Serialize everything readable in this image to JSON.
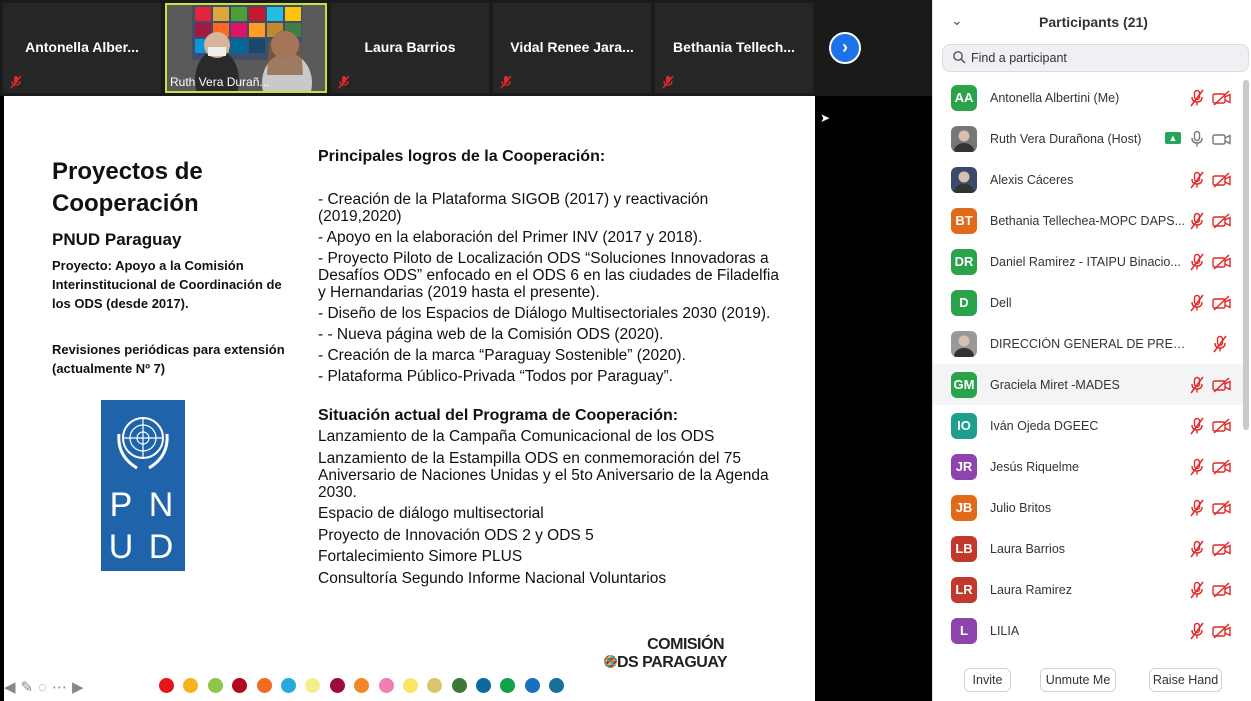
{
  "video_strip": {
    "tiles": [
      {
        "name": "Antonella  Alber..."
      },
      {
        "name": "Ruth Vera Durañ..."
      },
      {
        "name": "Laura Barrios"
      },
      {
        "name": "Vidal Renee Jara..."
      },
      {
        "name": "Bethania  Tellech..."
      }
    ]
  },
  "slide": {
    "left_title": "Proyectos de Cooperación",
    "left_subtitle": "PNUD Paraguay",
    "left_project": "Proyecto: Apoyo a la Comisión Interinstitucional de Coordinación de los ODS (desde 2017).",
    "left_revisions": "Revisiones periódicas para extensión (actualmente Nº 7)",
    "logo_letters": [
      "P",
      "N",
      "U",
      "D"
    ],
    "achievements_title": "Principales logros de la Cooperación:",
    "achievements": [
      "- Creación de la Plataforma SIGOB (2017) y reactivación (2019,2020)",
      "- Apoyo en la elaboración del Primer INV (2017 y 2018).",
      "- Proyecto Piloto de Localización ODS “Soluciones Innovadoras a Desafíos ODS” enfocado en el ODS 6 en las ciudades de Filadelfia y Hernandarias (2019 hasta el presente).",
      "- Diseño de los Espacios de Diálogo Multisectoriales 2030 (2019).",
      "- - Nueva página web de la Comisión ODS (2020).",
      "- Creación de la marca “Paraguay Sostenible” (2020).",
      " - Plataforma Público-Privada “Todos por Paraguay”."
    ],
    "status_title": "Situación actual del Programa de Cooperación:",
    "status_items": [
      "Lanzamiento de la Campaña Comunicacional de los ODS",
      "Lanzamiento de la Estampilla ODS en conmemoración del 75 Aniversario de Naciones Unidas y el 5to Aniversario de la Agenda 2030.",
      "Espacio de diálogo multisectorial",
      "Proyecto de Innovación ODS 2 y ODS 5",
      "Fortalecimiento Simore PLUS",
      "Consultoría Segundo Informe Nacional Voluntarios"
    ],
    "comision_line1": "COMISIÓN",
    "comision_line2": "DS PARAGUAY"
  },
  "annotation_colors": [
    "#e8141c",
    "#f7b21f",
    "#8fc54b",
    "#b3071e",
    "#f06c1f",
    "#27a8e0",
    "#f4ef8d",
    "#9c0b3e",
    "#f38727",
    "#f27eb4",
    "#fce566",
    "#d9c66a",
    "#3a7a34",
    "#0d6aa0",
    "#12a04a",
    "#1a6fbf",
    "#1a6f9a"
  ],
  "participants": {
    "title": "Participants (21)",
    "search_placeholder": "Find a participant",
    "list": [
      {
        "initials": "AA",
        "name": "Antonella Albertini (Me)",
        "color": "#2ba34b",
        "mic": "muted",
        "cam": "off"
      },
      {
        "initials": "",
        "name": "Ruth Vera Durañona (Host)",
        "color": "#777777",
        "mic": "on",
        "cam": "on",
        "photo": true
      },
      {
        "initials": "",
        "name": "Alexis Cáceres",
        "color": "#3b4a6b",
        "mic": "muted",
        "cam": "off",
        "photo": true
      },
      {
        "initials": "BT",
        "name": "Bethania Tellechea-MOPC DAPS...",
        "color": "#e06a1a",
        "mic": "muted",
        "cam": "off"
      },
      {
        "initials": "DR",
        "name": "Daniel Ramirez - ITAIPU Binacio...",
        "color": "#2ba34b",
        "mic": "muted",
        "cam": "off"
      },
      {
        "initials": "D",
        "name": "Dell",
        "color": "#2ba34b",
        "mic": "muted",
        "cam": "off"
      },
      {
        "initials": "",
        "name": "DIRECCIÓN GENERAL DE PRESUPUE...",
        "color": "#999999",
        "mic": "muted",
        "cam": "none",
        "photo": true
      },
      {
        "initials": "GM",
        "name": "Graciela Miret -MADES",
        "color": "#2ba34b",
        "mic": "muted",
        "cam": "off"
      },
      {
        "initials": "IO",
        "name": "Iván Ojeda DGEEC",
        "color": "#1e9e8e",
        "mic": "muted",
        "cam": "off"
      },
      {
        "initials": "JR",
        "name": "Jesús Riquelme",
        "color": "#8e44ad",
        "mic": "muted",
        "cam": "off"
      },
      {
        "initials": "JB",
        "name": "Julio Britos",
        "color": "#e06a1a",
        "mic": "muted",
        "cam": "off"
      },
      {
        "initials": "LB",
        "name": "Laura Barrios",
        "color": "#c0392b",
        "mic": "muted",
        "cam": "off"
      },
      {
        "initials": "LR",
        "name": "Laura Ramirez",
        "color": "#c0392b",
        "mic": "muted",
        "cam": "off"
      },
      {
        "initials": "L",
        "name": "LILIA",
        "color": "#8e44ad",
        "mic": "muted",
        "cam": "off"
      }
    ],
    "buttons": {
      "invite": "Invite",
      "unmute": "Unmute Me",
      "raise": "Raise Hand"
    }
  }
}
